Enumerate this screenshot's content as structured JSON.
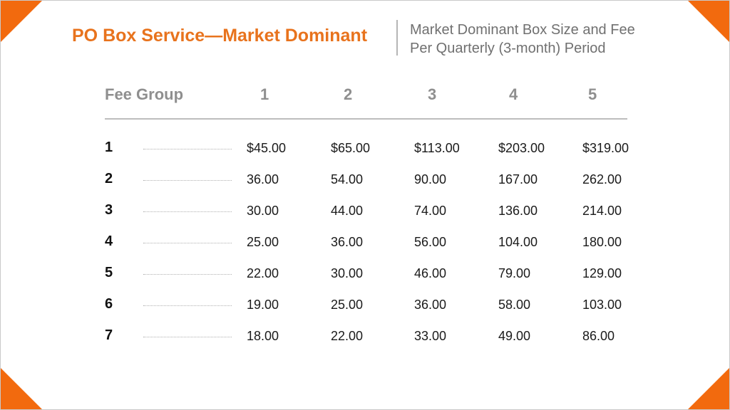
{
  "title": "PO Box Service—Market Dominant",
  "subtitle": {
    "line1": "Market Dominant Box Size and Fee",
    "line2": "Per Quarterly (3-month) Period"
  },
  "table": {
    "headers": [
      "Fee Group",
      "1",
      "2",
      "3",
      "4",
      "5"
    ],
    "rows": [
      {
        "group": "1",
        "values": [
          "$45.00",
          "$65.00",
          "$113.00",
          "$203.00",
          "$319.00"
        ]
      },
      {
        "group": "2",
        "values": [
          "36.00",
          "54.00",
          "90.00",
          "167.00",
          "262.00"
        ]
      },
      {
        "group": "3",
        "values": [
          "30.00",
          "44.00",
          "74.00",
          "136.00",
          "214.00"
        ]
      },
      {
        "group": "4",
        "values": [
          "25.00",
          "36.00",
          "56.00",
          "104.00",
          "180.00"
        ]
      },
      {
        "group": "5",
        "values": [
          "22.00",
          "30.00",
          "46.00",
          "79.00",
          "129.00"
        ]
      },
      {
        "group": "6",
        "values": [
          "19.00",
          "25.00",
          "36.00",
          "58.00",
          "103.00"
        ]
      },
      {
        "group": "7",
        "values": [
          "18.00",
          "22.00",
          "33.00",
          "49.00",
          "86.00"
        ]
      }
    ]
  },
  "colors": {
    "accent": "#f26a0e",
    "title": "#e8731d",
    "subtitle": "#707070",
    "header": "#8f8f8f"
  }
}
